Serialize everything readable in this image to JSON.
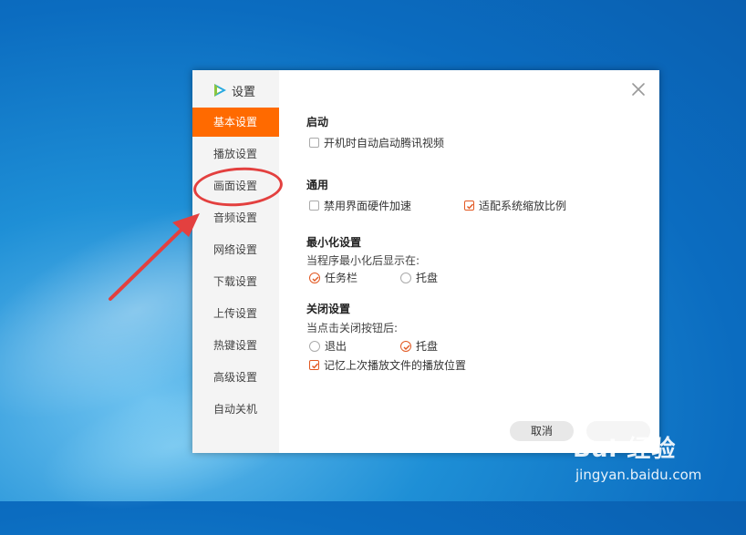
{
  "dialog": {
    "title": "设置",
    "close_icon": "close-icon"
  },
  "sidebar": {
    "items": [
      {
        "label": "基本设置",
        "active": true
      },
      {
        "label": "播放设置"
      },
      {
        "label": "画面设置"
      },
      {
        "label": "音频设置"
      },
      {
        "label": "网络设置"
      },
      {
        "label": "下载设置"
      },
      {
        "label": "上传设置"
      },
      {
        "label": "热键设置"
      },
      {
        "label": "高级设置"
      },
      {
        "label": "自动关机"
      }
    ]
  },
  "content": {
    "startup": {
      "title": "启动",
      "autostart_label": "开机时自动启动腾讯视频",
      "autostart_checked": false
    },
    "general": {
      "title": "通用",
      "disable_hw_label": "禁用界面硬件加速",
      "disable_hw_checked": false,
      "fit_scale_label": "适配系统缩放比例",
      "fit_scale_checked": true
    },
    "minimize": {
      "title": "最小化设置",
      "prompt": "当程序最小化后显示在:",
      "taskbar_label": "任务栏",
      "taskbar_selected": true,
      "tray_label": "托盘",
      "tray_selected": false
    },
    "close": {
      "title": "关闭设置",
      "prompt": "当点击关闭按钮后:",
      "exit_label": "退出",
      "exit_selected": false,
      "tray_label": "托盘",
      "tray_selected": true,
      "remember_label": "记忆上次播放文件的播放位置",
      "remember_checked": true
    }
  },
  "buttons": {
    "cancel_label": "取消"
  },
  "watermark": {
    "brand": "Bai 经验",
    "url": "jingyan.baidu.com"
  },
  "colors": {
    "accent": "#ff6a00",
    "check": "#e25822",
    "annotation": "#e3403f"
  }
}
